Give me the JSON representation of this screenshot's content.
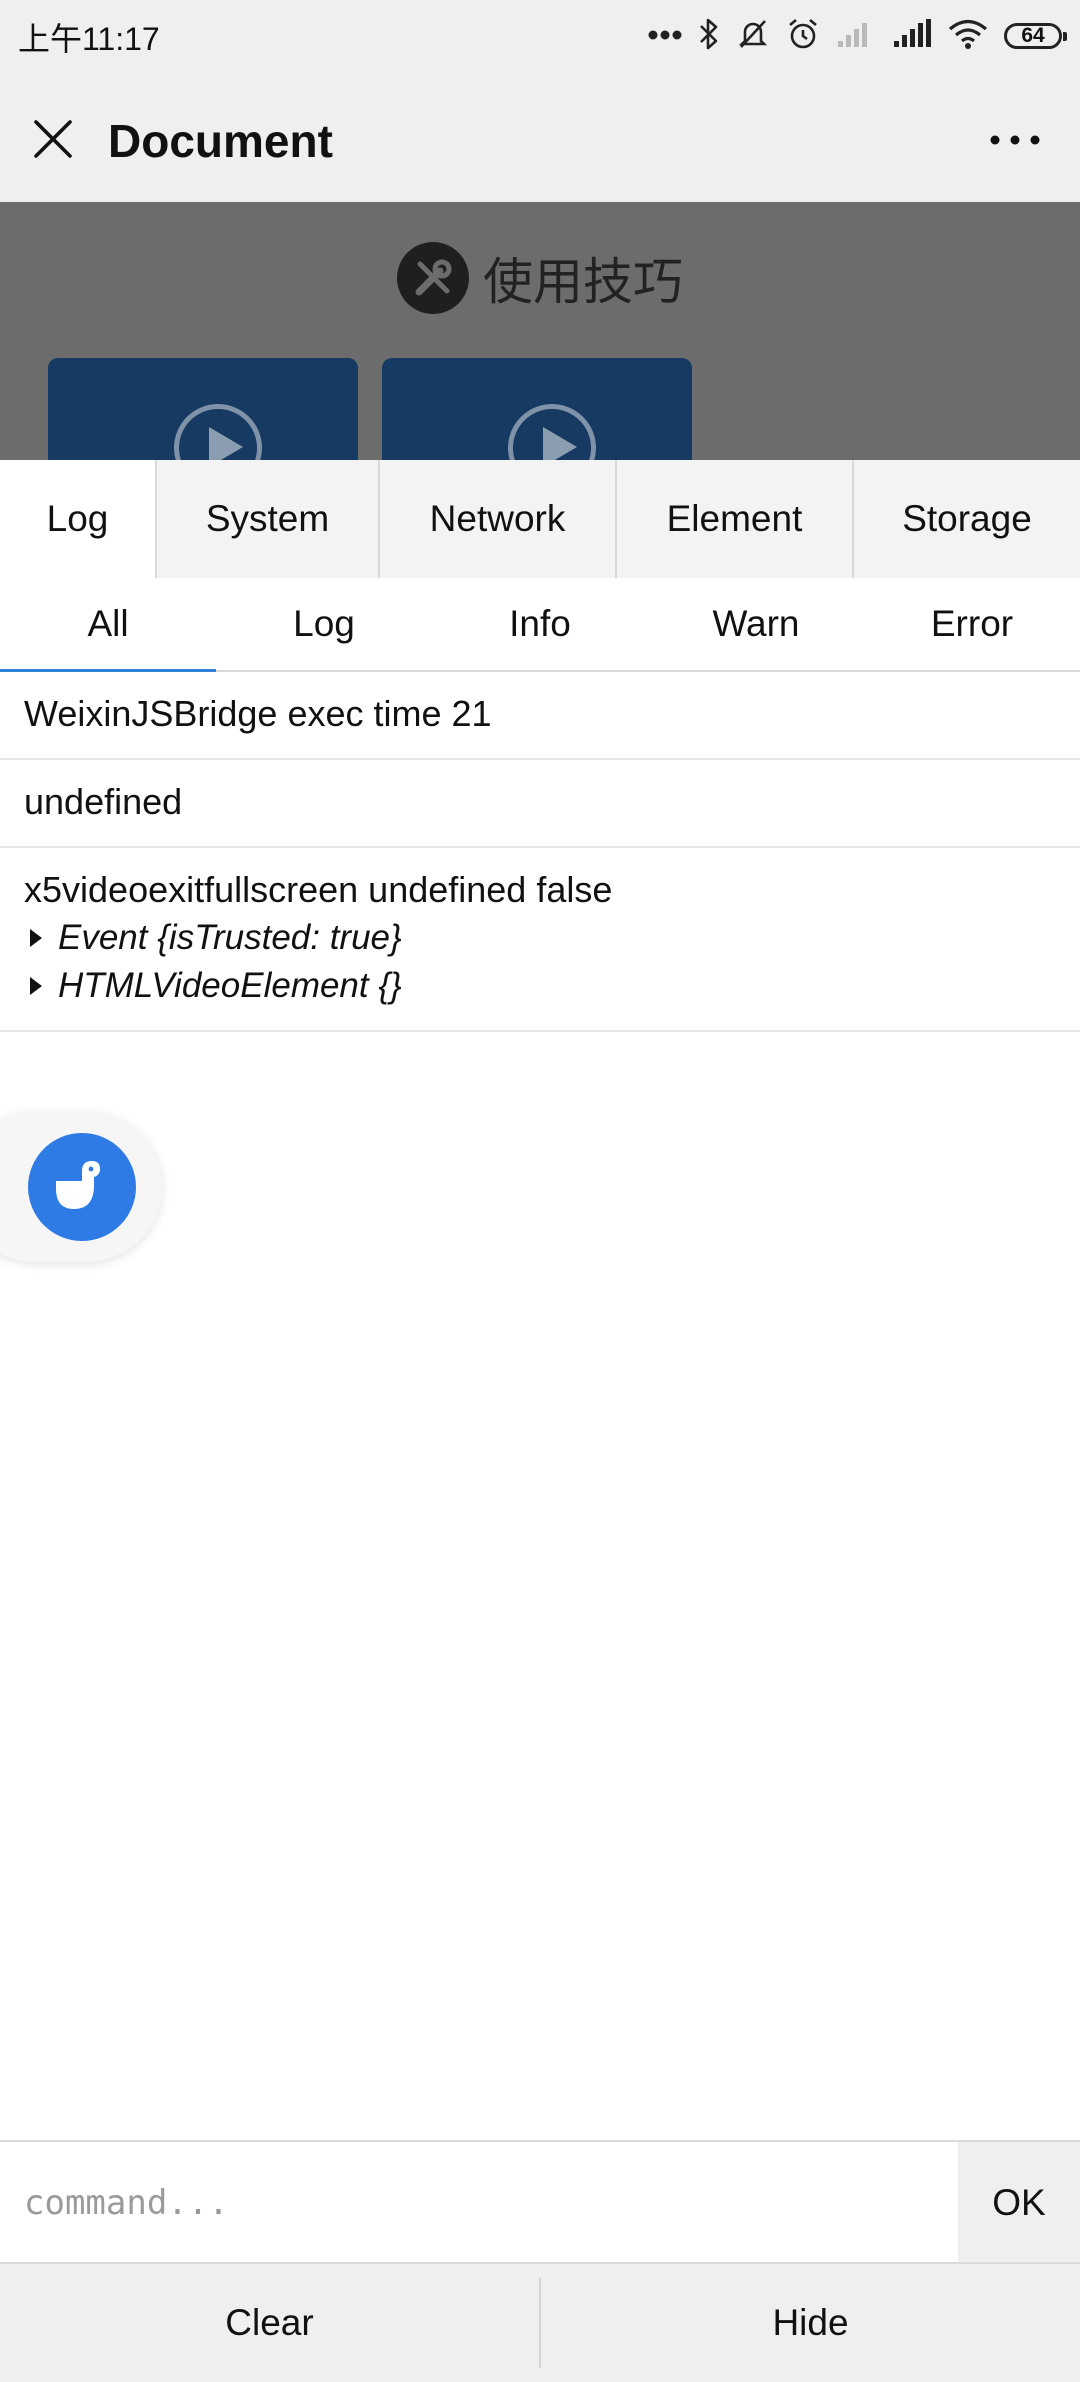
{
  "status_bar": {
    "time": "上午11:17",
    "battery": "64"
  },
  "title_bar": {
    "title": "Document"
  },
  "page": {
    "heading": "使用技巧"
  },
  "tabs": [
    {
      "label": "Log"
    },
    {
      "label": "System"
    },
    {
      "label": "Network"
    },
    {
      "label": "Element"
    },
    {
      "label": "Storage"
    }
  ],
  "active_tab": "Log",
  "subtabs": [
    {
      "label": "All"
    },
    {
      "label": "Log"
    },
    {
      "label": "Info"
    },
    {
      "label": "Warn"
    },
    {
      "label": "Error"
    }
  ],
  "active_subtab": "All",
  "logs": [
    {
      "text": "WeixinJSBridge exec time 21"
    },
    {
      "text": "undefined"
    },
    {
      "text": "x5videoexitfullscreen undefined false",
      "objects": [
        "Event {isTrusted: true}",
        "HTMLVideoElement {}"
      ]
    }
  ],
  "command": {
    "placeholder": "command...",
    "value": "",
    "ok_label": "OK"
  },
  "bottom": {
    "clear_label": "Clear",
    "hide_label": "Hide"
  }
}
